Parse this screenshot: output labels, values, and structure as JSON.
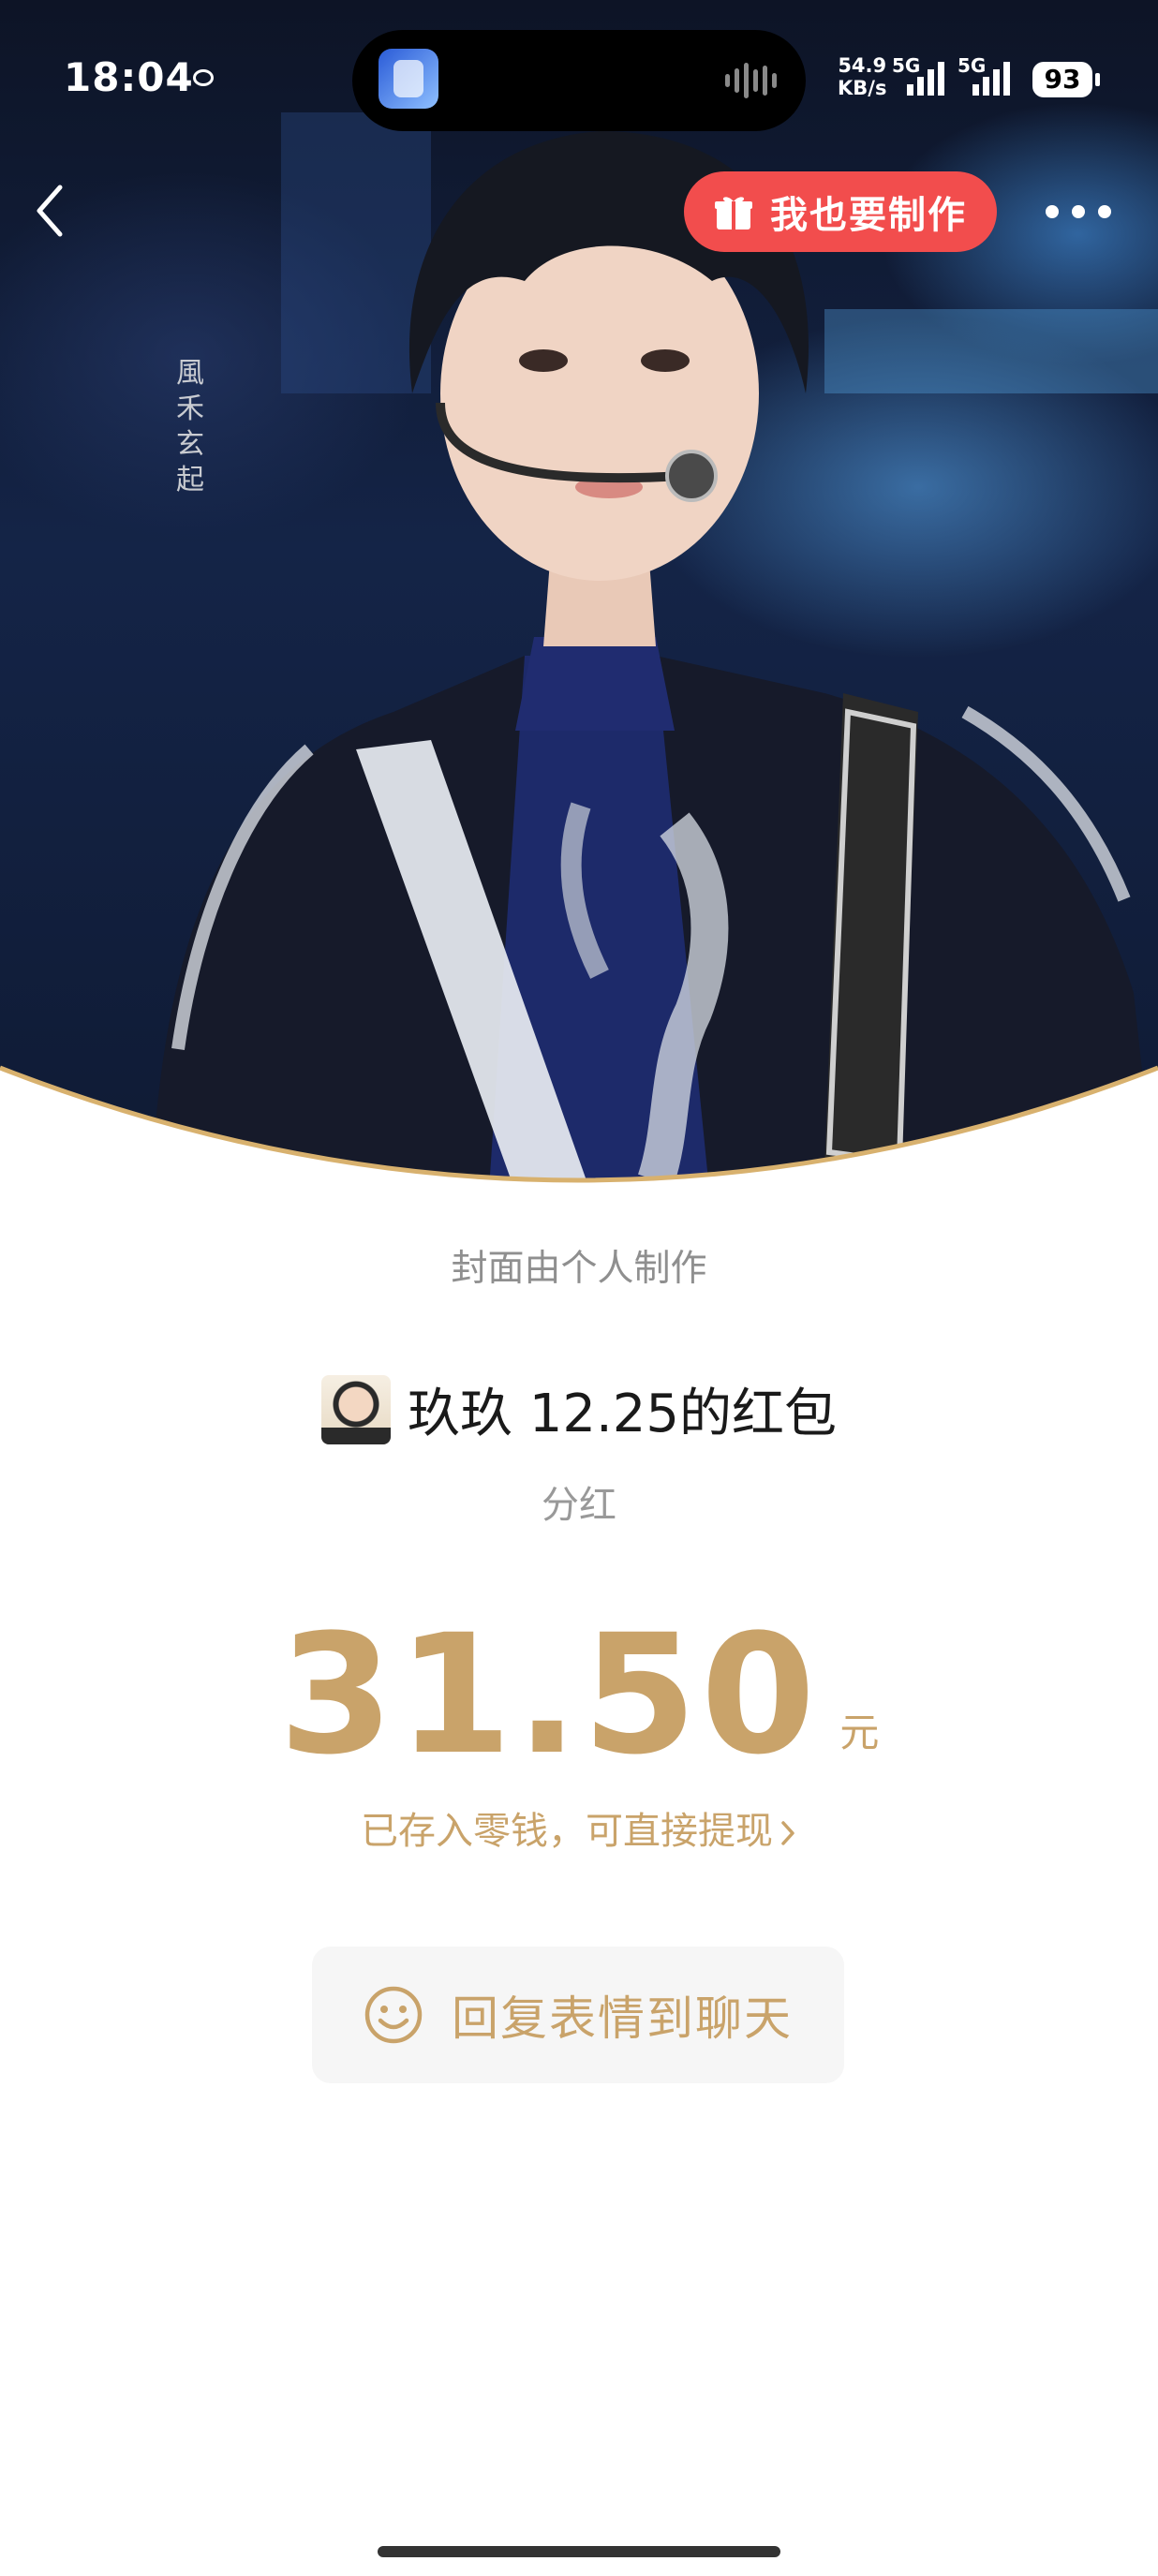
{
  "status_bar": {
    "time": "18:04",
    "net_speed_value": "54.9",
    "net_speed_unit": "KB/s",
    "sim1": "5G",
    "sim2": "5G",
    "battery": "93"
  },
  "nav": {
    "make_button_label": "我也要制作",
    "back_icon": "chevron-left-icon",
    "more_icon": "more-horizontal-icon"
  },
  "cover": {
    "watermark_text": "風禾玄起",
    "note": "封面由个人制作"
  },
  "packet": {
    "sender_title": "玖玖 12.25的红包",
    "subtype": "分红",
    "amount": "31.50",
    "unit": "元",
    "stored_note": "已存入零钱，可直接提现"
  },
  "reply_button": {
    "label": "回复表情到聊天",
    "icon": "smile-icon"
  },
  "colors": {
    "accent_gold": "#c9a36a",
    "make_button_red": "#f24d4d"
  }
}
